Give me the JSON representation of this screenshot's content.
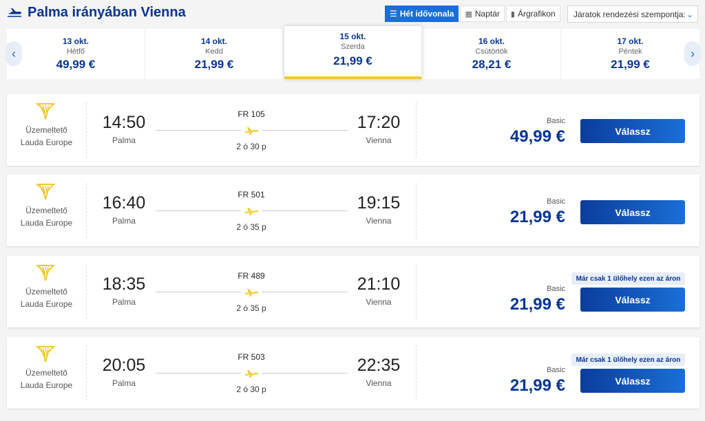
{
  "header": {
    "title": "Palma irányában Vienna",
    "views": [
      {
        "label": "Hét idővonala",
        "icon": "list-icon",
        "active": true
      },
      {
        "label": "Naptár",
        "icon": "calendar-icon",
        "active": false
      },
      {
        "label": "Árgrafikon",
        "icon": "bar-chart-icon",
        "active": false
      }
    ],
    "sort_label": "Járatok rendezési szempontja:"
  },
  "dates": [
    {
      "date": "13 okt.",
      "weekday": "Hétfő",
      "price": "49,99 €"
    },
    {
      "date": "14 okt.",
      "weekday": "Kedd",
      "price": "21,99 €"
    },
    {
      "date": "15 okt.",
      "weekday": "Szerda",
      "price": "21,99 €",
      "selected": true
    },
    {
      "date": "16 okt.",
      "weekday": "Csütörtök",
      "price": "28,21 €"
    },
    {
      "date": "17 okt.",
      "weekday": "Péntek",
      "price": "21,99 €"
    }
  ],
  "flights": [
    {
      "operator": "Üzemeltető Lauda Europe",
      "dep_time": "14:50",
      "dep_city": "Palma",
      "flight_no": "FR 105",
      "duration": "2 ó 30 p",
      "arr_time": "17:20",
      "arr_city": "Vienna",
      "fare_type": "Basic",
      "price": "49,99 €",
      "button": "Válassz",
      "badge": ""
    },
    {
      "operator": "Üzemeltető Lauda Europe",
      "dep_time": "16:40",
      "dep_city": "Palma",
      "flight_no": "FR 501",
      "duration": "2 ó 35 p",
      "arr_time": "19:15",
      "arr_city": "Vienna",
      "fare_type": "Basic",
      "price": "21,99 €",
      "button": "Válassz",
      "badge": ""
    },
    {
      "operator": "Üzemeltető Lauda Europe",
      "dep_time": "18:35",
      "dep_city": "Palma",
      "flight_no": "FR 489",
      "duration": "2 ó 35 p",
      "arr_time": "21:10",
      "arr_city": "Vienna",
      "fare_type": "Basic",
      "price": "21,99 €",
      "button": "Válassz",
      "badge": "Már csak 1 ülőhely ezen az áron"
    },
    {
      "operator": "Üzemeltető Lauda Europe",
      "dep_time": "20:05",
      "dep_city": "Palma",
      "flight_no": "FR 503",
      "duration": "2 ó 30 p",
      "arr_time": "22:35",
      "arr_city": "Vienna",
      "fare_type": "Basic",
      "price": "21,99 €",
      "button": "Válassz",
      "badge": "Már csak 1 ülőhely ezen az áron"
    }
  ],
  "colors": {
    "brand_blue": "#073590",
    "accent_yellow": "#f1c933",
    "button_blue": "#1a6fd6"
  }
}
